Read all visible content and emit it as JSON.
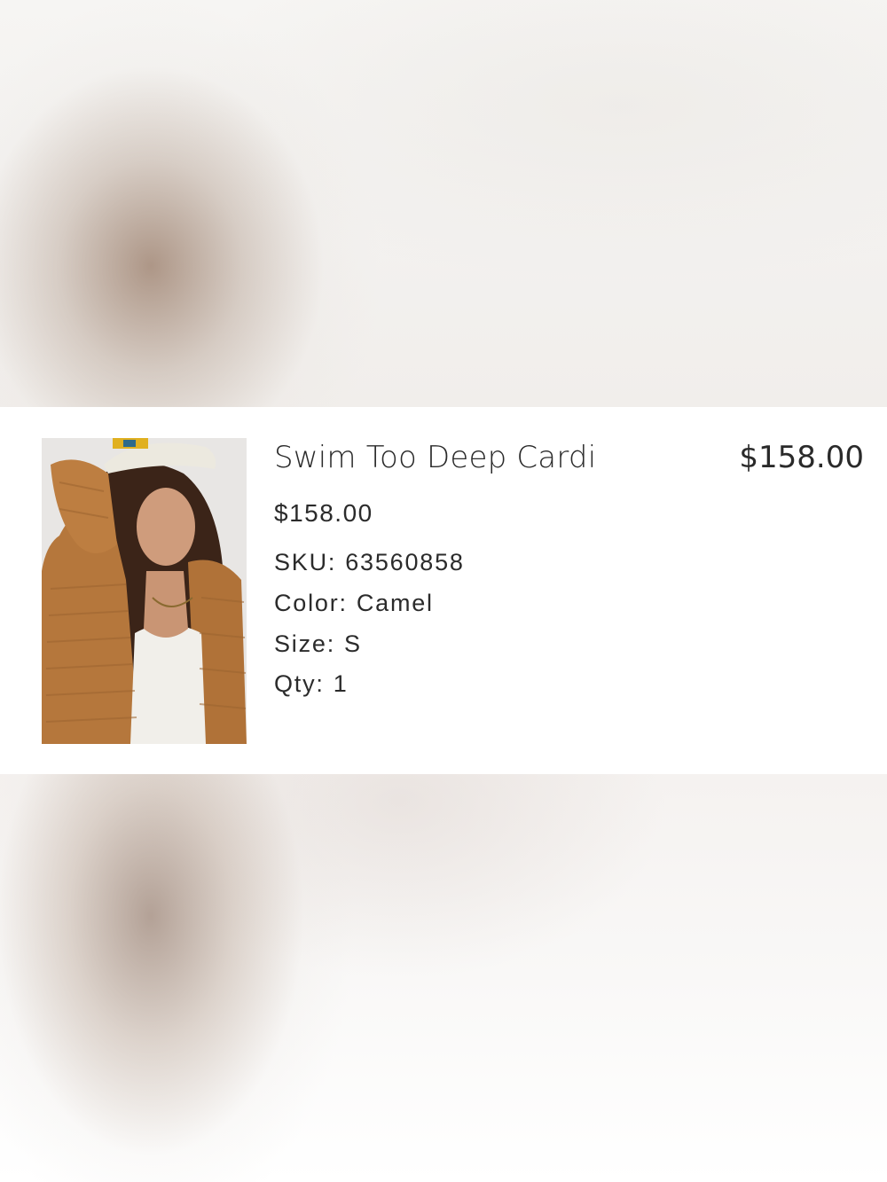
{
  "item": {
    "name": "Swim Too Deep Cardi",
    "line_total": "$158.00",
    "unit_price": "$158.00",
    "sku_label": "SKU:",
    "sku": "63560858",
    "color_label": "Color:",
    "color": "Camel",
    "size_label": "Size:",
    "size": "S",
    "qty_label": "Qty:",
    "qty": "1",
    "image_alt": "product-photo-model-in-camel-cardigan"
  },
  "colors": {
    "text": "#2a2a2a",
    "camel": "#b87a3e",
    "background": "#ffffff"
  }
}
